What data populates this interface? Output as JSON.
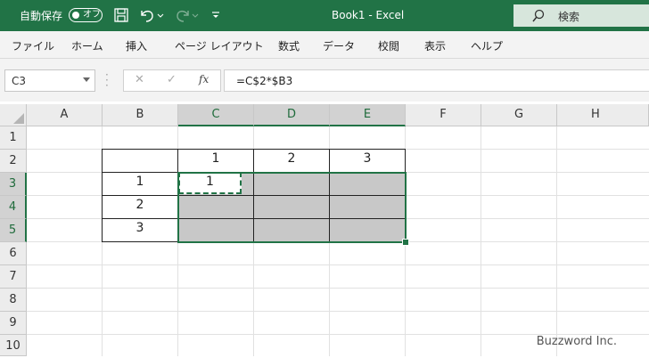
{
  "titlebar": {
    "autosave_label": "自動保存",
    "autosave_state": "オフ",
    "doc_title": "Book1  -  Excel",
    "search_label": "検索"
  },
  "menu": [
    "ファイル",
    "ホーム",
    "挿入",
    "ページ レイアウト",
    "数式",
    "データ",
    "校閲",
    "表示",
    "ヘルプ"
  ],
  "formula_bar": {
    "name_box": "C3",
    "formula": "=C$2*$B3",
    "fx": "fx"
  },
  "columns": [
    "A",
    "B",
    "C",
    "D",
    "E",
    "F",
    "G",
    "H"
  ],
  "selected_columns": [
    "C",
    "D",
    "E"
  ],
  "rows": [
    "1",
    "2",
    "3",
    "4",
    "5",
    "6",
    "7",
    "8",
    "9",
    "10"
  ],
  "selected_rows": [
    "3",
    "4",
    "5"
  ],
  "cells": {
    "C2": "1",
    "D2": "2",
    "E2": "3",
    "B3": "1",
    "B4": "2",
    "B5": "3",
    "C3": "1"
  },
  "watermark": "Buzzword Inc.",
  "colors": {
    "accent": "#217346",
    "selection_fill": "#c8c8c8"
  }
}
